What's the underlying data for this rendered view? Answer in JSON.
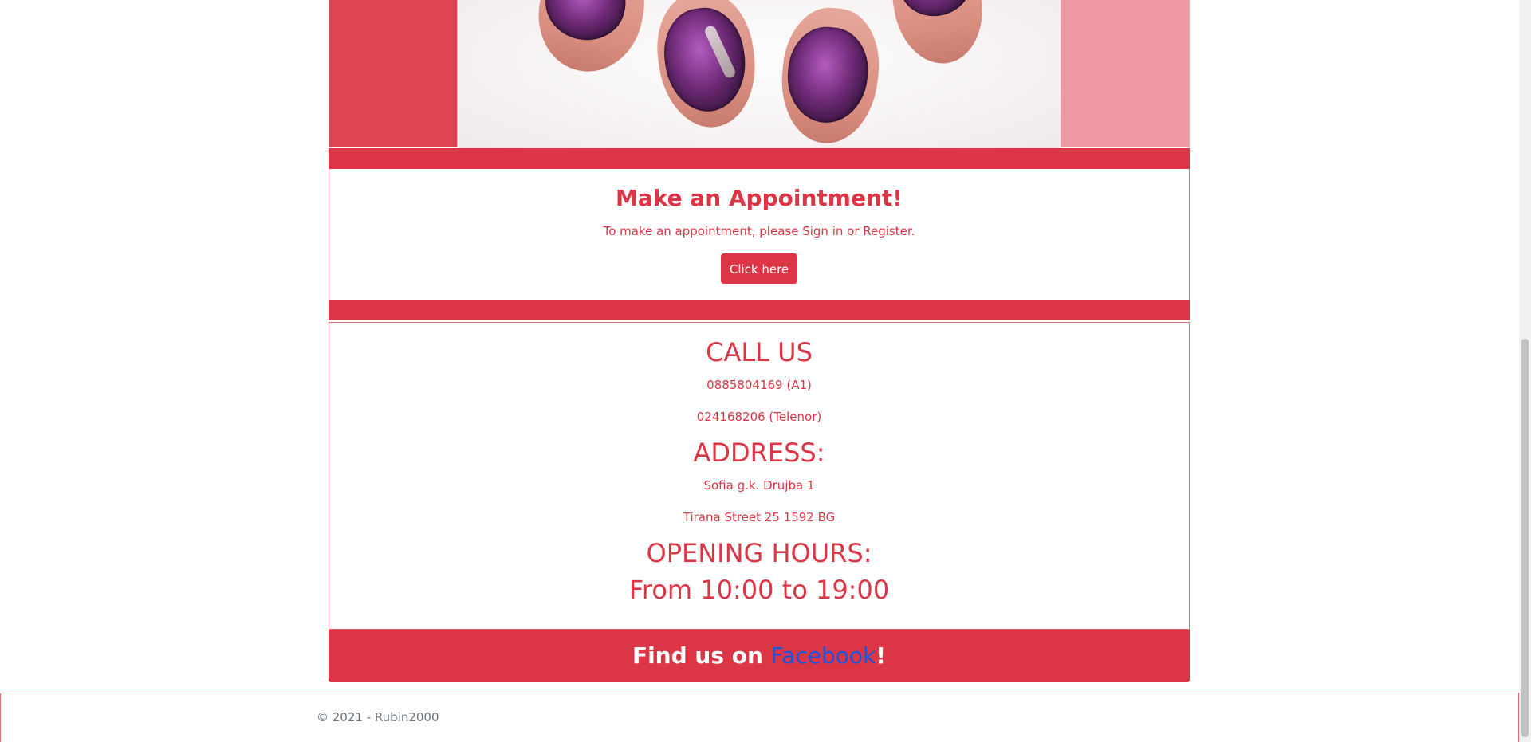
{
  "appointment": {
    "title": "Make an Appointment!",
    "text": "To make an appointment, please Sign in or Register.",
    "button_label": "Click here"
  },
  "contact": {
    "call_title": "CALL US",
    "phones": [
      "0885804169 (A1)",
      "024168206 (Telenor)"
    ],
    "address_title": "ADDRESS:",
    "address_lines": [
      "Sofia g.k. Drujba 1",
      "Tirana Street 25 1592 BG"
    ],
    "hours_title": "OPENING HOURS:",
    "hours_text": "From 10:00 to 19:00"
  },
  "facebook": {
    "prefix": "Find us on ",
    "link_label": "Facebook",
    "suffix": "!"
  },
  "footer": {
    "copyright": "© 2021 - Rubin2000"
  },
  "colors": {
    "accent": "#dc3545",
    "link": "#1a56db",
    "muted": "#6c757d"
  }
}
